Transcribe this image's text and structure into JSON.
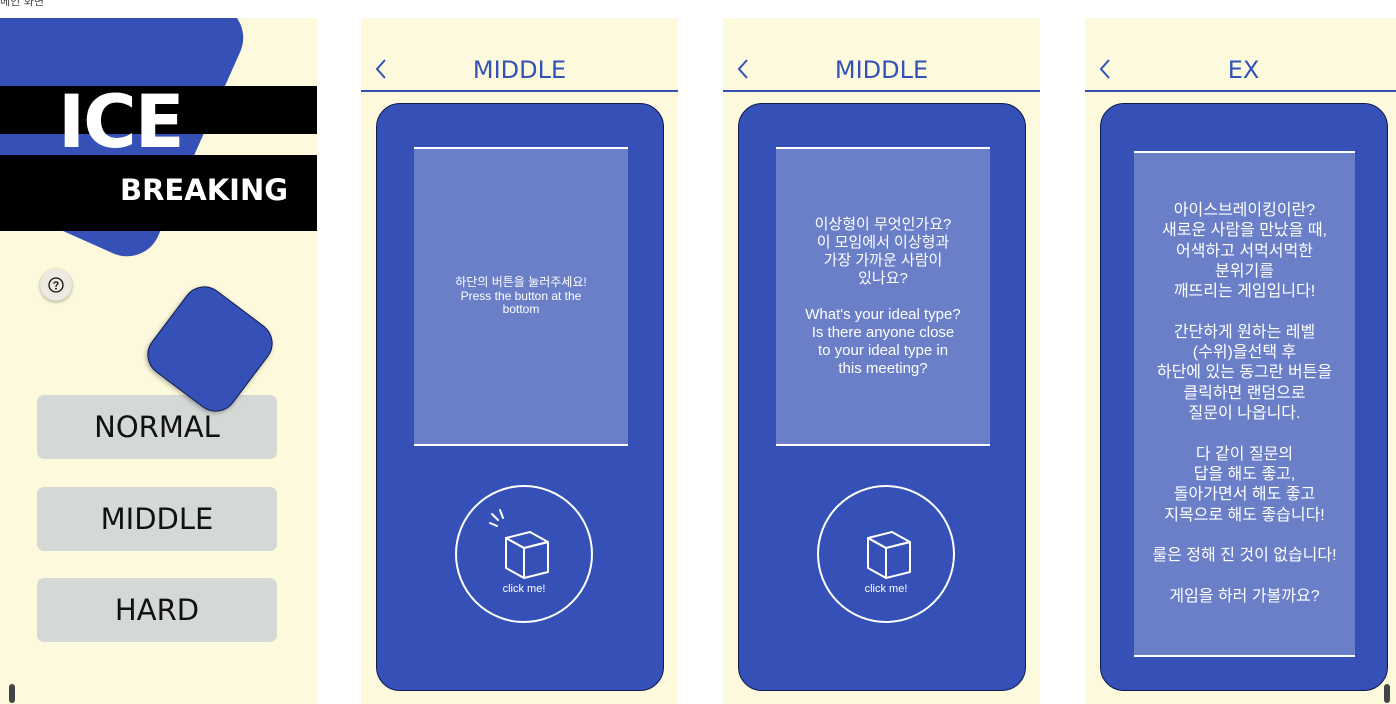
{
  "caption": "메인 화면",
  "colors": {
    "cream": "#fdf9dc",
    "blue": "#3551b8",
    "panel": "#6a7fc7",
    "button_gray": "#d5d9d6"
  },
  "screen1": {
    "title_main": "ICE",
    "title_sub": "BREAKING",
    "help_icon": "question-circle-icon",
    "buttons": {
      "normal": "NORMAL",
      "middle": "MIDDLE",
      "hard": "HARD"
    }
  },
  "screen2": {
    "title": "MIDDLE",
    "question": "하단의 버튼을 눌러주세요!\nPress the button at the\nbottom",
    "click_label": "click me!",
    "click_icon": "box-icon"
  },
  "screen3": {
    "title": "MIDDLE",
    "question": "이상형이 무엇인가요?\n이 모임에서 이상형과\n가장 가까운 사람이\n있나요?\n\nWhat's your ideal type?\nIs there anyone close\nto your ideal type in\nthis meeting?",
    "click_label": "click me!",
    "click_icon": "box-icon"
  },
  "screen4": {
    "title": "EX",
    "description": "아이스브레이킹이란?\n새로운 사람을 만났을 때,\n어색하고 서먹서먹한\n분위기를\n깨뜨리는 게임입니다!\n\n간단하게 원하는 레벨\n(수위)을선택 후\n하단에 있는 동그란 버튼을\n클릭하면 랜덤으로\n질문이 나옵니다.\n\n다 같이 질문의\n답을 해도 좋고,\n돌아가면서 해도 좋고\n지목으로 해도 좋습니다!\n\n룰은 정해 진 것이 없습니다!\n\n게임을 하러 가볼까요?"
  }
}
